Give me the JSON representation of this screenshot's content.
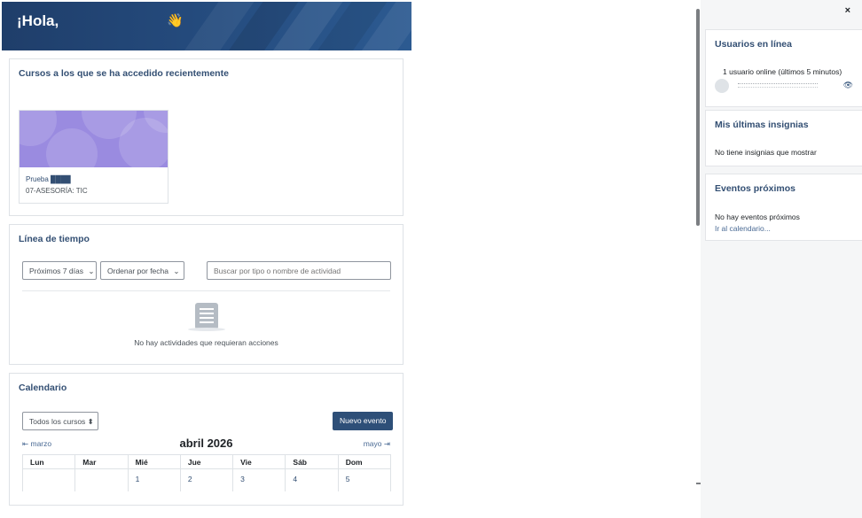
{
  "header": {
    "greeting": "¡Hola,",
    "wave_icon": "👋"
  },
  "recent_courses": {
    "title": "Cursos a los que se ha accedido recientemente",
    "course": {
      "name": "Prueba ████",
      "category": "07-ASESORÍA: TIC"
    }
  },
  "timeline": {
    "title": "Línea de tiempo",
    "filter_days": "Próximos 7 días",
    "sort": "Ordenar por fecha",
    "search_placeholder": "Buscar por tipo o nombre de actividad",
    "empty_text": "No hay actividades que requieran acciones",
    "chevron": "⌄"
  },
  "calendar": {
    "title": "Calendario",
    "course_filter": "Todos los cursos ⬍",
    "new_event": "Nuevo evento",
    "prev_month": "⇤  marzo",
    "next_month": "mayo  ⇥",
    "month_title": "abril 2026",
    "weekdays": [
      "Lun",
      "Mar",
      "Mié",
      "Jue",
      "Vie",
      "Sáb",
      "Dom"
    ],
    "first_week": [
      "",
      "",
      "1",
      "2",
      "3",
      "4",
      "5"
    ]
  },
  "drawer": {
    "close_icon": "×",
    "online_users": {
      "title": "Usuarios en línea",
      "count_text": "1 usuario online (últimos 5 minutos)",
      "eye_icon": "👁"
    },
    "badges": {
      "title": "Mis últimas insignias",
      "empty_text": "No tiene insignias que mostrar"
    },
    "upcoming": {
      "title": "Eventos próximos",
      "empty_text": "No hay eventos próximos",
      "calendar_link": "Ir al calendario..."
    }
  }
}
